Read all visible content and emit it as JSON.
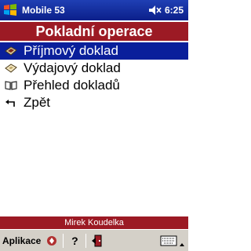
{
  "titlebar": {
    "app_title": "Mobile 53",
    "clock": "6:25"
  },
  "header": {
    "title": "Pokladní operace"
  },
  "menu": {
    "items": [
      {
        "label": "Příjmový doklad",
        "icon": "receipt-in-icon",
        "selected": true
      },
      {
        "label": "Výdajový doklad",
        "icon": "receipt-out-icon",
        "selected": false
      },
      {
        "label": "Přehled dokladů",
        "icon": "book-icon",
        "selected": false
      },
      {
        "label": "Zpět",
        "icon": "back-arrow-icon",
        "selected": false
      }
    ]
  },
  "footer": {
    "user": "Mirek Koudelka"
  },
  "cmdbar": {
    "menu_label": "Aplikace",
    "help_label": "?"
  },
  "colors": {
    "titlebar": "#0b1f8a",
    "header": "#9c1a24",
    "selection": "#0a1f9b",
    "cmdbar": "#d4d0c8"
  }
}
